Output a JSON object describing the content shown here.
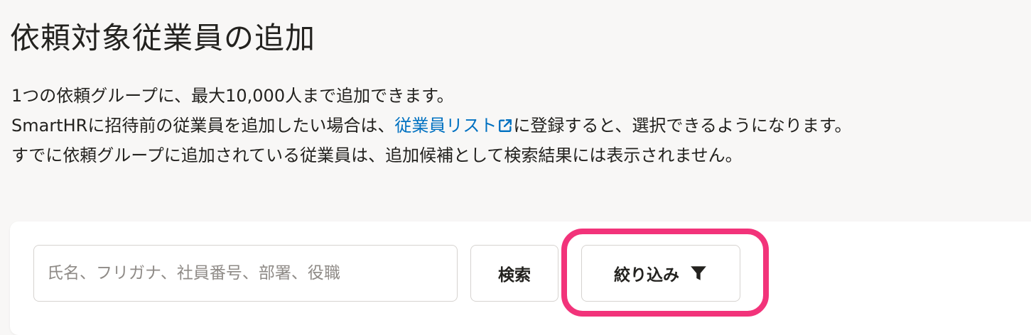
{
  "page": {
    "title": "依頼対象従業員の追加"
  },
  "description": {
    "line1": "1つの依頼グループに、最大10,000人まで追加できます。",
    "line2_prefix": "SmartHRに招待前の従業員を追加したい場合は、",
    "line2_link": "従業員リスト",
    "line2_suffix": "に登録すると、選択できるようになります。",
    "line3": "すでに依頼グループに追加されている従業員は、追加候補として検索結果には表示されません。"
  },
  "search": {
    "placeholder": "氏名、フリガナ、社員番号、部署、役職",
    "value": "",
    "search_label": "検索",
    "filter_label": "絞り込み"
  },
  "icons": {
    "link": "external-link-icon",
    "filter": "filter-funnel-icon"
  },
  "colors": {
    "link": "#0071c1",
    "highlight": "#f2337a",
    "background": "#f8f7f6"
  }
}
